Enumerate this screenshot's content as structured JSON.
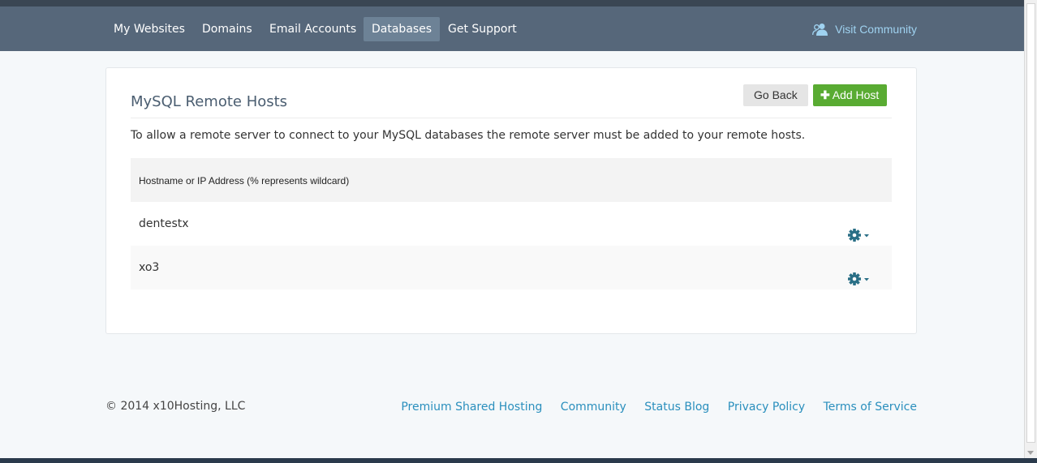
{
  "nav": {
    "items": [
      {
        "label": "My Websites"
      },
      {
        "label": "Domains"
      },
      {
        "label": "Email Accounts"
      },
      {
        "label": "Databases",
        "active": true
      },
      {
        "label": "Get Support"
      }
    ],
    "community_label": "Visit Community"
  },
  "panel": {
    "title": "MySQL Remote Hosts",
    "go_back_label": "Go Back",
    "add_host_label": "Add Host",
    "description": "To allow a remote server to connect to your MySQL databases the remote server must be added to your remote hosts.",
    "table": {
      "header": "Hostname or IP Address (% represents wildcard)",
      "rows": [
        {
          "host": "dentestx"
        },
        {
          "host": "xo3"
        }
      ]
    }
  },
  "footer": {
    "copyright": "© 2014 x10Hosting, LLC",
    "links": [
      "Premium Shared Hosting",
      "Community",
      "Status Blog",
      "Privacy Policy",
      "Terms of Service"
    ]
  },
  "colors": {
    "nav_bg": "#56677a",
    "accent_link": "#2a8fbd",
    "add_button": "#59ab32",
    "gear": "#2a6f86"
  },
  "icons": {
    "community": "users-icon",
    "settings": "gear-icon",
    "add": "plus-icon"
  }
}
